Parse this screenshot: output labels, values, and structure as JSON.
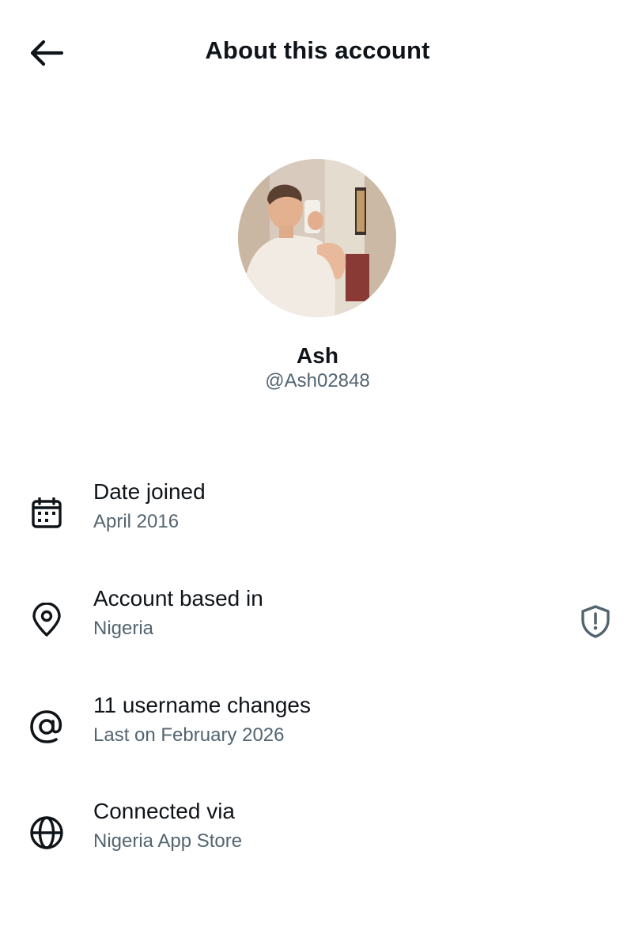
{
  "header": {
    "title": "About this account",
    "back_icon": "arrow-left-icon"
  },
  "profile": {
    "name": "Ash",
    "handle": "@Ash02848"
  },
  "rows": [
    {
      "icon": "calendar-icon",
      "title": "Date joined",
      "subtitle": "April 2016"
    },
    {
      "icon": "location-pin-icon",
      "title": "Account based in",
      "subtitle": "Nigeria",
      "trailing_icon": "shield-exclamation-icon"
    },
    {
      "icon": "at-sign-icon",
      "title": "11 username changes",
      "subtitle": "Last on February 2026"
    },
    {
      "icon": "globe-icon",
      "title": "Connected via",
      "subtitle": "Nigeria App Store"
    }
  ],
  "colors": {
    "text_primary": "#0f1419",
    "text_secondary": "#536471",
    "background": "#ffffff"
  }
}
